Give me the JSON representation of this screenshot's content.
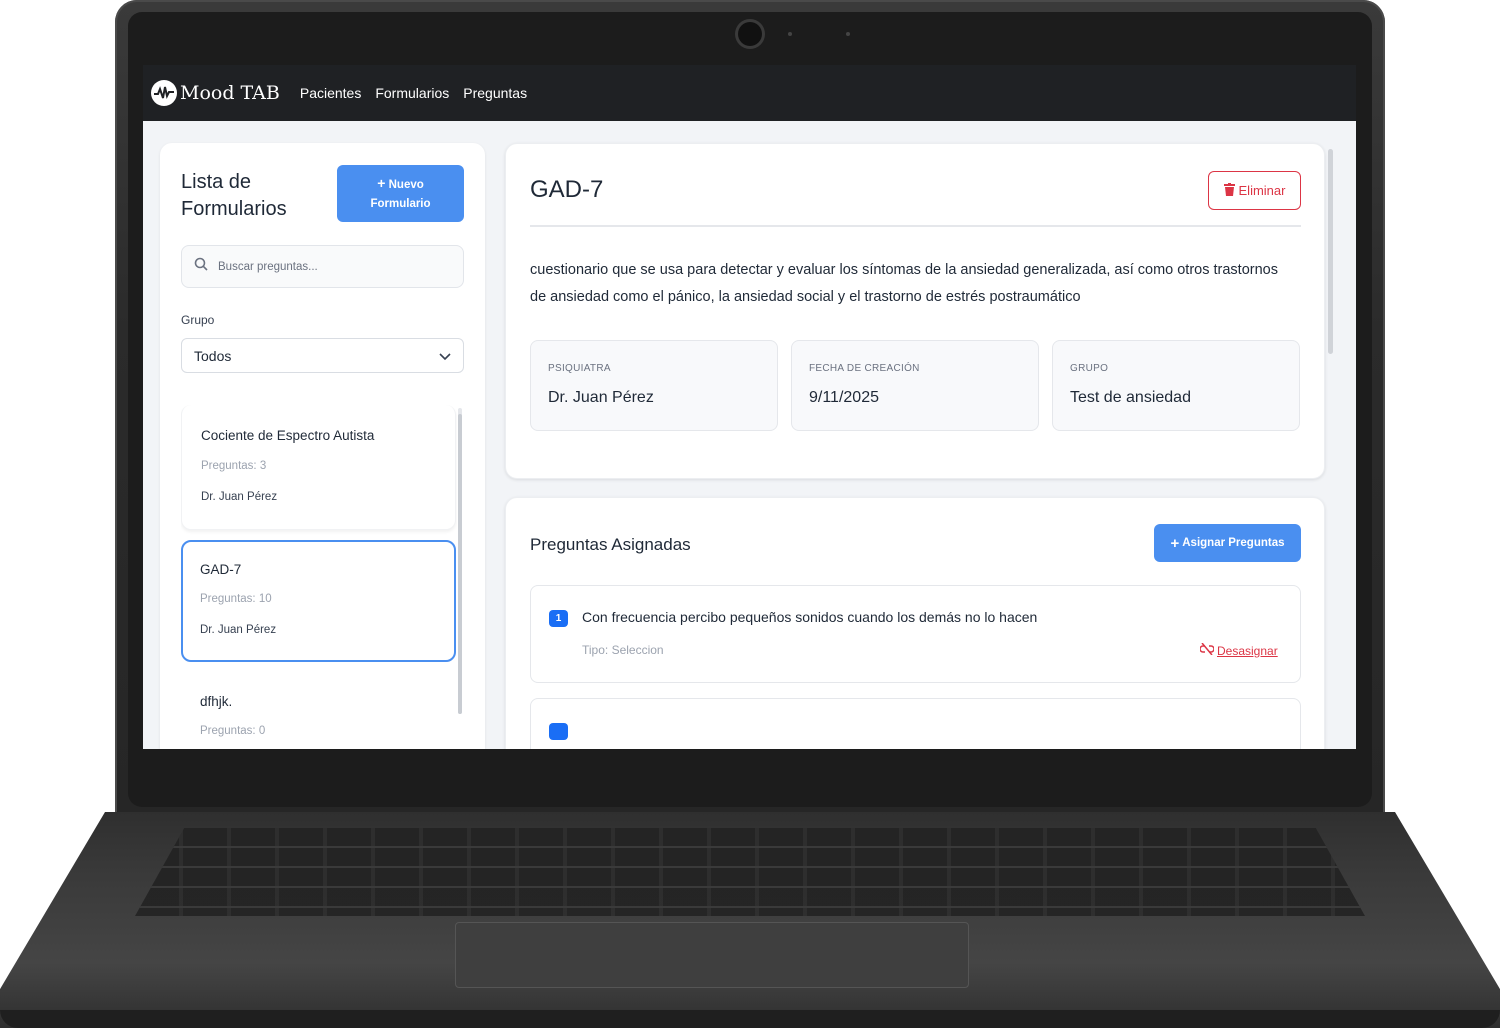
{
  "navbar": {
    "brand": "Mood TAB",
    "links": [
      "Pacientes",
      "Formularios",
      "Preguntas"
    ]
  },
  "sidebar": {
    "title": "Lista de Formularios",
    "new_button_icon": "+",
    "new_button_line1": "Nuevo",
    "new_button_line2": "Formulario",
    "search_placeholder": "Buscar preguntas...",
    "group_label": "Grupo",
    "group_selected": "Todos",
    "forms": [
      {
        "name": "Cociente de Espectro Autista",
        "count": "Preguntas: 3",
        "doctor": "Dr. Juan Pérez"
      },
      {
        "name": "GAD-7",
        "count": "Preguntas: 10",
        "doctor": "Dr. Juan Pérez"
      },
      {
        "name": "dfhjk.",
        "count": "Preguntas: 0"
      }
    ]
  },
  "detail": {
    "title": "GAD-7",
    "delete_label": "Eliminar",
    "description": "cuestionario que se usa para detectar y evaluar los síntomas de la ansiedad generalizada, así como otros trastornos de ansiedad como el pánico, la ansiedad social y el trastorno de estrés postraumático",
    "info": [
      {
        "label": "PSIQUIATRA",
        "value": "Dr. Juan Pérez"
      },
      {
        "label": "FECHA DE CREACIÓN",
        "value": "9/11/2025"
      },
      {
        "label": "GRUPO",
        "value": "Test de ansiedad"
      }
    ]
  },
  "questions": {
    "title": "Preguntas Asignadas",
    "assign_label": "Asignar Preguntas",
    "items": [
      {
        "number": "1",
        "text": "Con frecuencia percibo pequeños sonidos cuando los demás no lo hacen",
        "type": "Tipo: Seleccion",
        "unassign_label": "Desasignar"
      }
    ]
  },
  "colors": {
    "primary": "#4a8ff0",
    "danger": "#dc3545",
    "navbar": "#1f2124"
  }
}
